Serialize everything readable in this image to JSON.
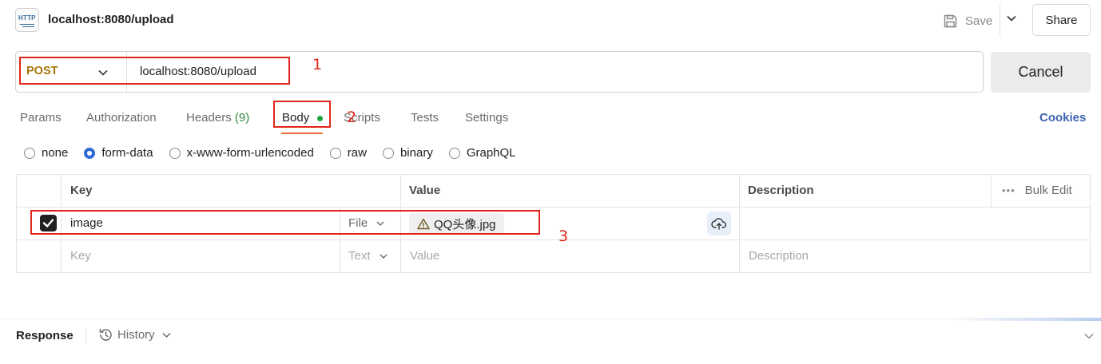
{
  "header": {
    "title": "localhost:8080/upload",
    "http_icon_label": "HTTP",
    "save_label": "Save",
    "share_label": "Share"
  },
  "request": {
    "method": "POST",
    "url": "localhost:8080/upload",
    "cancel_label": "Cancel"
  },
  "tabs": [
    {
      "label": "Params"
    },
    {
      "label": "Authorization"
    },
    {
      "label": "Headers",
      "count": "(9)"
    },
    {
      "label": "Body",
      "active": true
    },
    {
      "label": "Scripts"
    },
    {
      "label": "Tests"
    },
    {
      "label": "Settings"
    }
  ],
  "cookies_label": "Cookies",
  "body_types": [
    {
      "label": "none",
      "selected": false
    },
    {
      "label": "form-data",
      "selected": true
    },
    {
      "label": "x-www-form-urlencoded",
      "selected": false
    },
    {
      "label": "raw",
      "selected": false
    },
    {
      "label": "binary",
      "selected": false
    },
    {
      "label": "GraphQL",
      "selected": false
    }
  ],
  "table": {
    "headers": {
      "key": "Key",
      "value": "Value",
      "description": "Description"
    },
    "bulk_edit_label": "Bulk Edit",
    "bulk_edit_dots": "•••",
    "rows": [
      {
        "checked": true,
        "key": "image",
        "type": "File",
        "value": "QQ头像.jpg",
        "description": ""
      }
    ],
    "new_row": {
      "key_placeholder": "Key",
      "type": "Text",
      "value_placeholder": "Value",
      "description_placeholder": "Description"
    }
  },
  "annotations": {
    "a1": "1",
    "a2": "2",
    "a3": "3"
  },
  "response": {
    "label": "Response",
    "history_label": "History"
  },
  "colors": {
    "method": "#a8750b",
    "accent_link": "#3c64b1",
    "annotation_red": "#e0261a",
    "tab_underline": "#f26b3a",
    "body_dot": "#22a33b",
    "radio_selected": "#2e6bd6"
  }
}
